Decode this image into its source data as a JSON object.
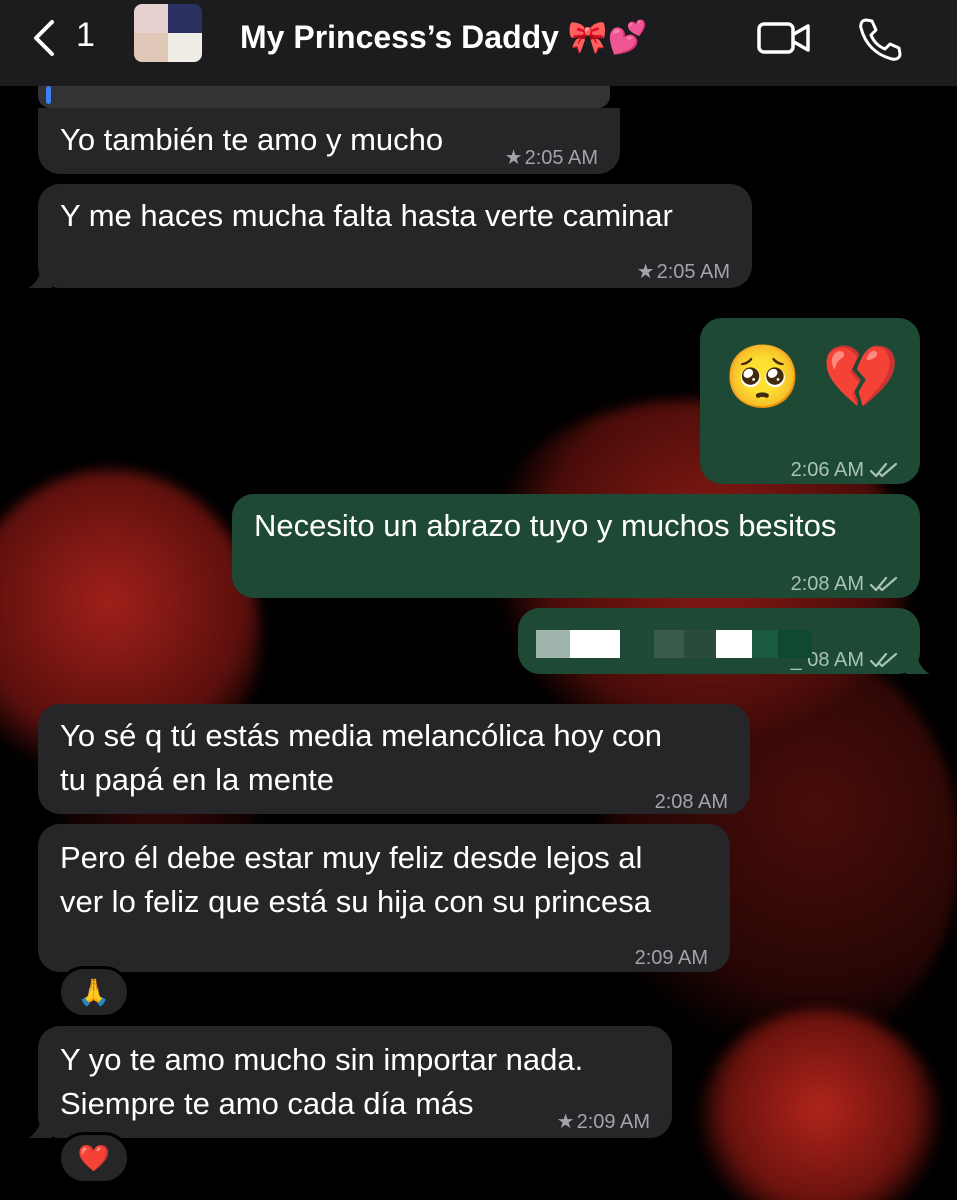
{
  "header": {
    "unread_count": "1",
    "contact_name": "My Princess’s Daddy 🎀💕"
  },
  "messages": [
    {
      "id": "m1",
      "dir": "in",
      "text": "Yo también te amo y mucho",
      "time": "2:05 AM",
      "starred": true
    },
    {
      "id": "m2",
      "dir": "in",
      "text": "Y me haces mucha falta hasta verte caminar",
      "time": "2:05 AM",
      "starred": true
    },
    {
      "id": "m3",
      "dir": "out",
      "text": "🥺 💔",
      "time": "2:06 AM",
      "status": "read"
    },
    {
      "id": "m4",
      "dir": "out",
      "text": "Necesito un abrazo tuyo y muchos besitos",
      "time": "2:08 AM",
      "status": "read"
    },
    {
      "id": "m5",
      "dir": "out",
      "text": "",
      "time": "_ 08 AM",
      "status": "read",
      "redacted": true
    },
    {
      "id": "m6",
      "dir": "in",
      "lines": [
        "Yo sé q tú estás media melancólica hoy con",
        "tu papá en la mente"
      ],
      "time": "2:08 AM"
    },
    {
      "id": "m7",
      "dir": "in",
      "lines": [
        "Pero él debe estar muy feliz desde lejos al",
        "ver lo feliz que está su hija con su princesa"
      ],
      "time": "2:09 AM",
      "reaction": "🙏"
    },
    {
      "id": "m8",
      "dir": "in",
      "lines": [
        "Y yo te amo mucho sin importar nada.",
        "Siempre te amo cada día más"
      ],
      "time": "2:09 AM",
      "starred": true,
      "reaction": "❤️"
    }
  ],
  "colors": {
    "incoming_bubble": "#262628",
    "outgoing_bubble": "#1e4a35",
    "header_bg": "#1c1c1e"
  }
}
